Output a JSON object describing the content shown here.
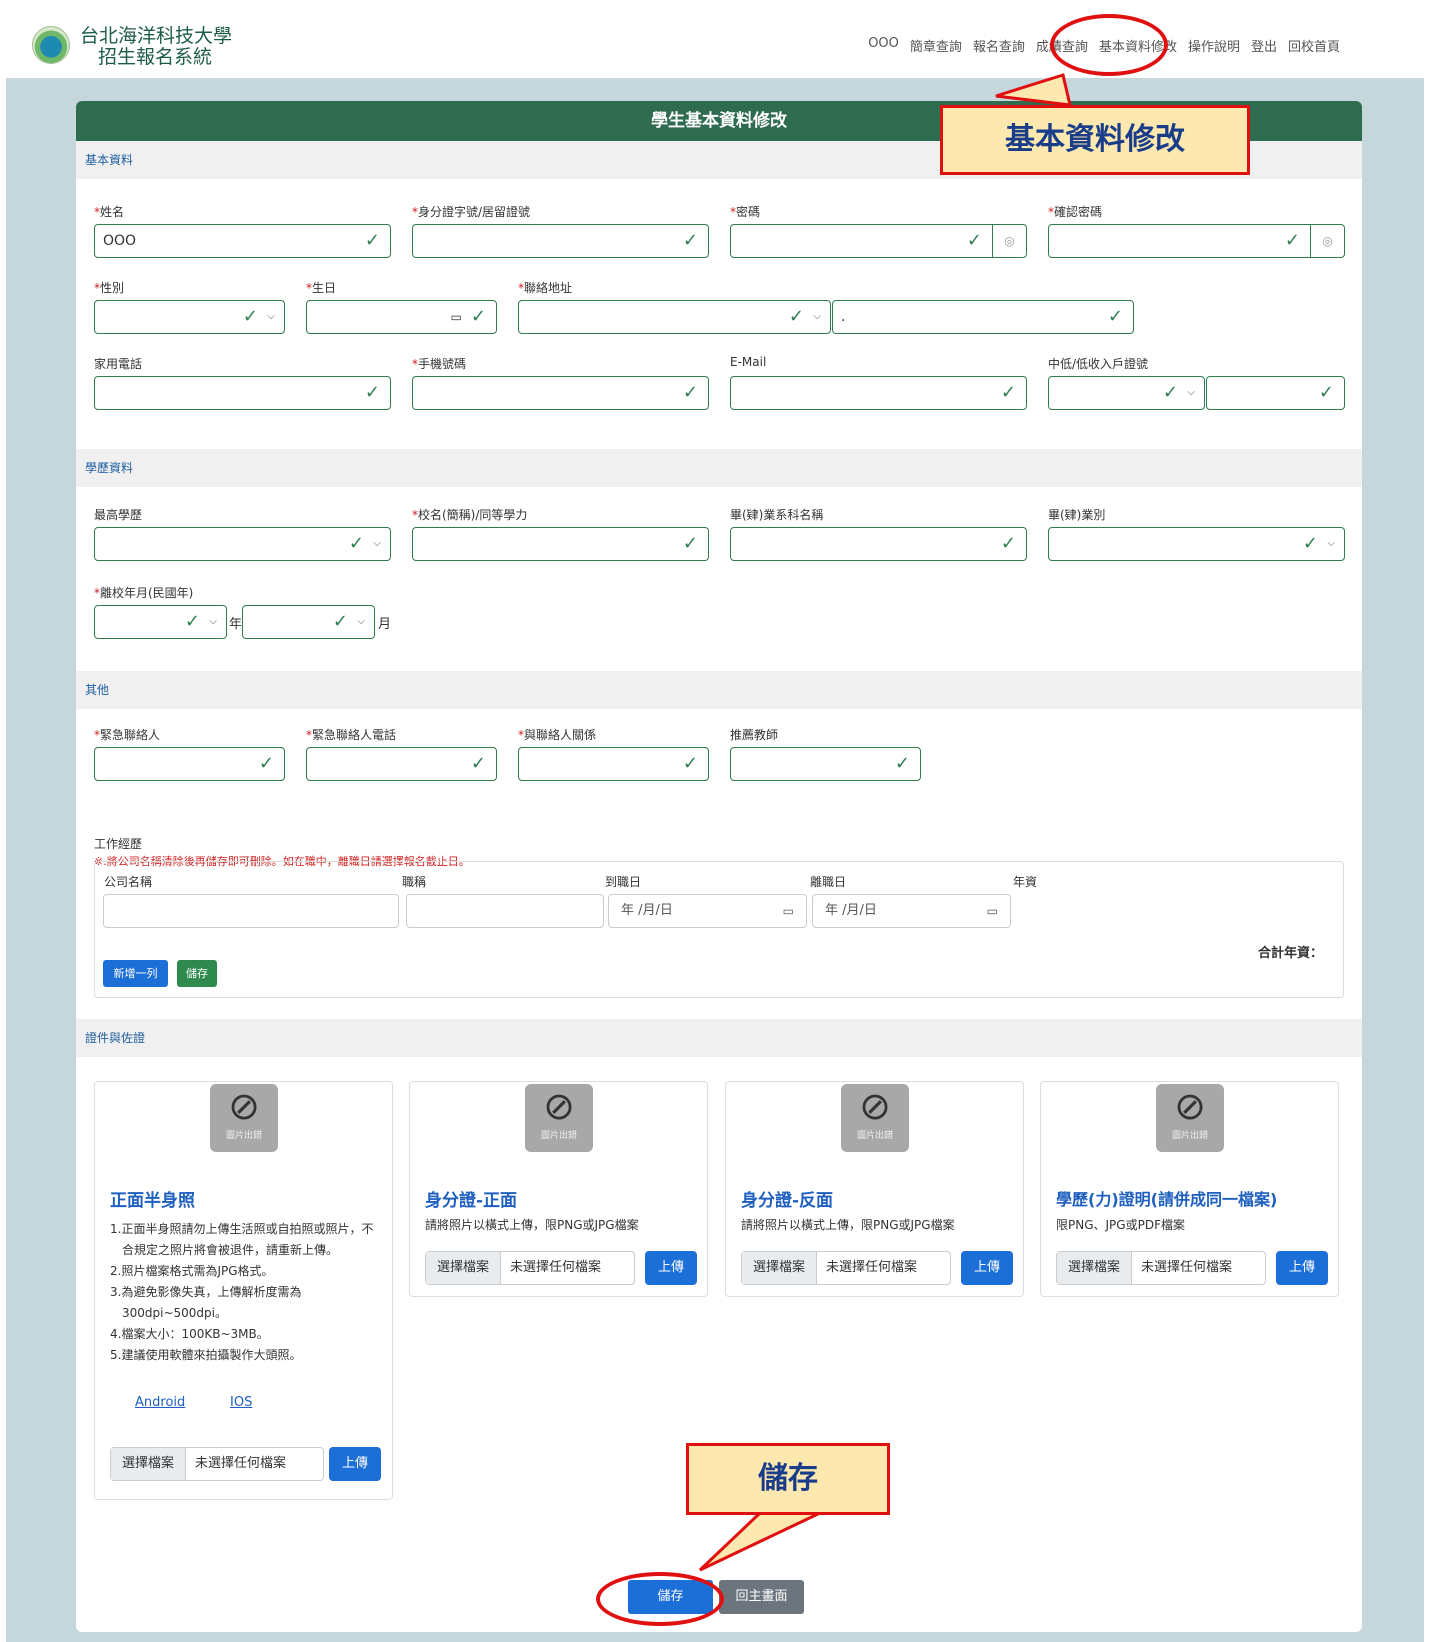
{
  "header": {
    "brand_line1": "台北海洋科技大學",
    "brand_line2": "招生報名系統",
    "nav": [
      "OOO",
      "簡章查詢",
      "報名查詢",
      "成績查詢",
      "基本資料修改",
      "操作說明",
      "登出",
      "回校首頁"
    ]
  },
  "form": {
    "title": "學生基本資料修改",
    "sections": {
      "basic": "基本資料",
      "education": "學歷資料",
      "other": "其他",
      "documents": "證件與佐證"
    },
    "basic": {
      "name_label": "姓名",
      "name_value": "OOO",
      "id_label": "身分證字號/居留證號",
      "password_label": "密碼",
      "confirm_label": "確認密碼",
      "gender_label": "性別",
      "birthday_label": "生日",
      "address_label": "聯絡地址",
      "address_detail_value": ".",
      "home_phone_label": "家用電話",
      "mobile_label": "手機號碼",
      "email_label": "E-Mail",
      "low_income_label": "中低/低收入戶證號"
    },
    "education": {
      "highest_label": "最高學歷",
      "school_label": "校名(簡稱)/同等學力",
      "dept_label": "畢(肄)業系科名稱",
      "grad_type_label": "畢(肄)業別",
      "leave_label": "離校年月(民國年)",
      "year_suffix": "年",
      "month_suffix": "月"
    },
    "other": {
      "contact_label": "緊急聯絡人",
      "contact_phone_label": "緊急聯絡人電話",
      "relation_label": "與聯絡人關係",
      "teacher_label": "推薦教師"
    },
    "work": {
      "title": "工作經歷",
      "note": "※.將公司名稱清除後再儲存即可刪除。如在職中，離職日請選擇報名截止日。",
      "col_company": "公司名稱",
      "col_title": "職稱",
      "col_start": "到職日",
      "col_end": "離職日",
      "col_years": "年資",
      "date_placeholder": "年 /月/日",
      "total_label": "合計年資：",
      "add_row": "新增一列",
      "save": "儲存"
    },
    "uploads": [
      {
        "title": "正面半身照",
        "desc": [
          "1.正面半身照請勿上傳生活照或自拍照或照片，不合規定之照片將會被退件，請重新上傳。",
          "2.照片檔案格式需為JPG格式。",
          "3.為避免影像失真，上傳解析度需為300dpi~500dpi。",
          "4.檔案大小：100KB~3MB。",
          "5.建議使用軟體來拍攝製作大頭照。"
        ],
        "links": [
          "Android",
          "IOS"
        ]
      },
      {
        "title": "身分證-正面",
        "desc": [
          "請將照片以橫式上傳，限PNG或JPG檔案"
        ]
      },
      {
        "title": "身分證-反面",
        "desc": [
          "請將照片以橫式上傳，限PNG或JPG檔案"
        ]
      },
      {
        "title": "學歷(力)證明(請併成同一檔案)",
        "desc": [
          "限PNG、JPG或PDF檔案"
        ]
      }
    ],
    "image_error": "圖片出錯",
    "choose_file": "選擇檔案",
    "no_file": "未選擇任何檔案",
    "upload": "上傳",
    "save_button": "儲存",
    "back_button": "回主畫面"
  },
  "annotations": {
    "callout_edit": "基本資料修改",
    "callout_save": "儲存",
    "annotation_color": "#e01010",
    "callout_fill": "#fde9b0"
  }
}
